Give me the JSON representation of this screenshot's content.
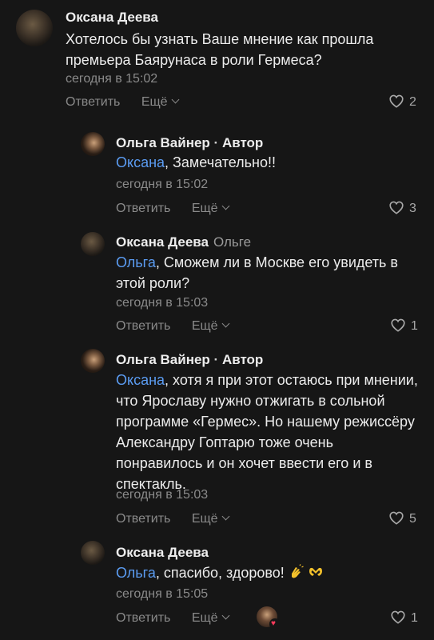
{
  "comments": [
    {
      "author": "Оксана Деева",
      "role": "",
      "reply_to": "",
      "mention": "",
      "text": "Хотелось бы узнать Ваше мнение как прошла премьера Баярунаса в роли Гермеса?",
      "time": "сегодня в 15:02",
      "reply_label": "Ответить",
      "more_label": "Ещё",
      "likes": "2"
    },
    {
      "author": "Ольга Вайнер",
      "role": "Автор",
      "reply_to": "",
      "mention": "Оксана",
      "text": ", Замечательно!!",
      "time": "сегодня в 15:02",
      "reply_label": "Ответить",
      "more_label": "Ещё",
      "likes": "3"
    },
    {
      "author": "Оксана Деева",
      "role": "",
      "reply_to": "Ольге",
      "mention": "Ольга",
      "text": ", Сможем ли в Москве его увидеть в этой роли?",
      "time": "сегодня в 15:03",
      "reply_label": "Ответить",
      "more_label": "Ещё",
      "likes": "1"
    },
    {
      "author": "Ольга Вайнер",
      "role": "Автор",
      "reply_to": "",
      "mention": "Оксана",
      "text": ", хотя я при этот остаюсь при мнении, что Ярославу нужно отжигать в сольной программе «Гермес». Но нашему режиссёру Александру Гоптарю тоже очень понравилось и он хочет ввести его и в спектакль.",
      "time": "сегодня в 15:03",
      "reply_label": "Ответить",
      "more_label": "Ещё",
      "likes": "5"
    },
    {
      "author": "Оксана Деева",
      "role": "",
      "reply_to": "",
      "mention": "Ольга",
      "text": ", спасибо, здорово! ",
      "time": "сегодня в 15:05",
      "reply_label": "Ответить",
      "more_label": "Ещё",
      "likes": "1"
    }
  ],
  "separator": "·",
  "icons": {
    "like": "heart-outline-icon",
    "more": "chevron-down-icon",
    "emoji_1": "clapping-hands-emoji",
    "emoji_2": "heart-hands-emoji",
    "author_like": "author-liked-heart-icon"
  },
  "colors": {
    "background": "#161616",
    "mention": "#5b9cf2",
    "muted": "#8a8a8a",
    "author_heart": "#ff3b5c"
  }
}
